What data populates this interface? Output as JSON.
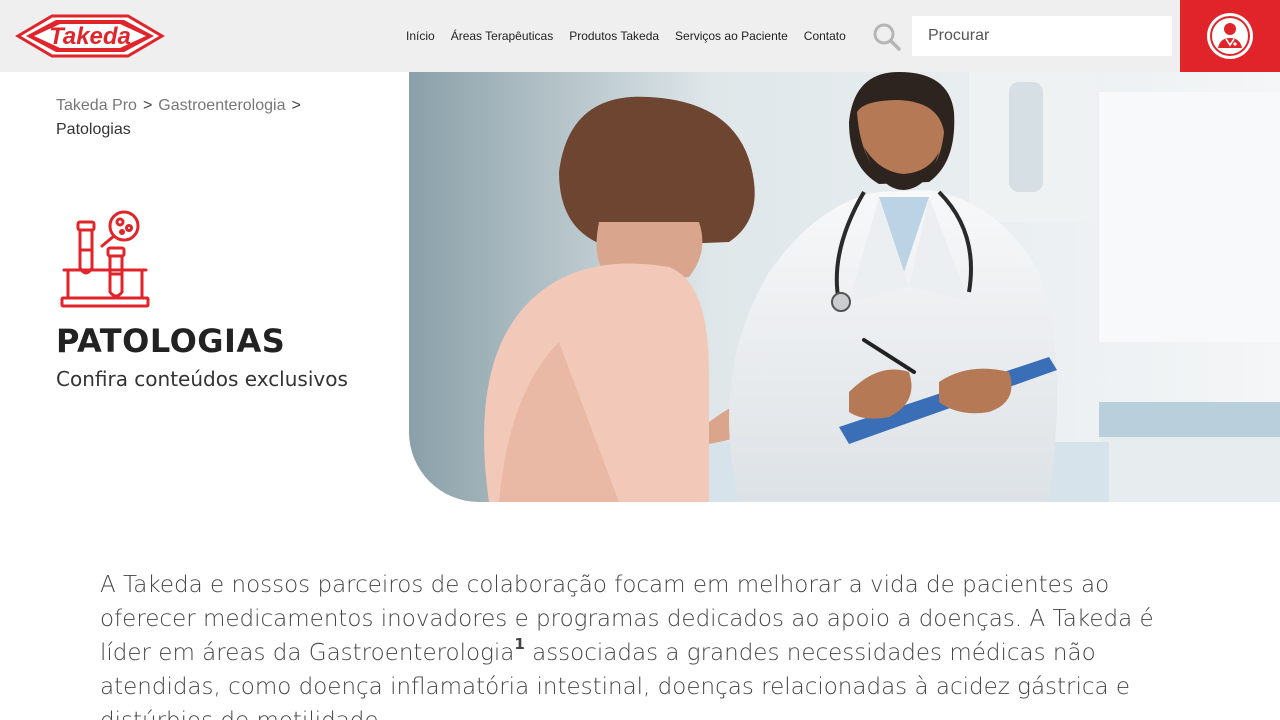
{
  "header": {
    "logo_text": "Takeda",
    "nav": [
      "Início",
      "Áreas Terapêuticas",
      "Produtos Takeda",
      "Serviços ao Paciente",
      "Contato"
    ],
    "search": {
      "placeholder": "Procurar"
    },
    "brand_color": "#e1242a"
  },
  "breadcrumb": {
    "items": [
      "Takeda Pro",
      "Gastroenterologia",
      "Patologias"
    ],
    "separator": ">"
  },
  "hero": {
    "icon": "lab-test-tubes-icon",
    "title": "PATOLOGIAS",
    "subtitle": "Confira conteúdos exclusivos"
  },
  "intro": {
    "text_before": "A Takeda e nossos parceiros de colaboração focam em melhorar a vida de pacientes ao oferecer medicamentos inovadores e programas dedicados ao apoio a doenças. A Takeda é líder em áreas da Gastroenterologia",
    "footnote": "1",
    "text_after": " associadas a grandes necessidades médicas não atendidas, como doença inflamatória intestinal, doenças relacionadas à acidez gástrica e distúrbios de motilidade."
  }
}
